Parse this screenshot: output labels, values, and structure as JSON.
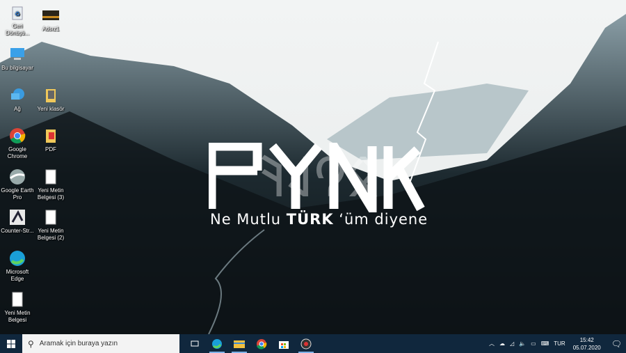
{
  "desktop_icons": [
    {
      "label": "Geri Dönüşü...",
      "icon": "recycle-bin-icon"
    },
    {
      "label": "Adsız1",
      "icon": "image-file-icon"
    },
    {
      "label": "Bu bilgisayar",
      "icon": "computer-icon"
    },
    {
      "label": "Ağ",
      "icon": "network-icon"
    },
    {
      "label": "Yeni klasör",
      "icon": "folder-icon"
    },
    {
      "label": "Google Chrome",
      "icon": "chrome-icon"
    },
    {
      "label": "PDF",
      "icon": "folder-icon"
    },
    {
      "label": "Google Earth Pro",
      "icon": "google-earth-icon"
    },
    {
      "label": "Yeni Metin Belgesi (3)",
      "icon": "text-file-icon"
    },
    {
      "label": "Counter-Str...",
      "icon": "counter-strike-icon"
    },
    {
      "label": "Yeni Metin Belgesi (2)",
      "icon": "text-file-icon"
    },
    {
      "label": "Microsoft Edge",
      "icon": "edge-icon"
    },
    {
      "label": "Yeni Metin Belgesi",
      "icon": "text-file-icon"
    }
  ],
  "wallpaper": {
    "runes": "𐰋𐰘𐰞𐰚",
    "slogan_pre": "Ne Mutlu ",
    "slogan_bold": "TÜRK",
    "slogan_post": " ‘üm diyene"
  },
  "taskbar": {
    "search_placeholder": "Aramak için buraya yazın",
    "language": "TUR",
    "time": "15:42",
    "date": "05.07.2020",
    "accent": "#10273d"
  }
}
